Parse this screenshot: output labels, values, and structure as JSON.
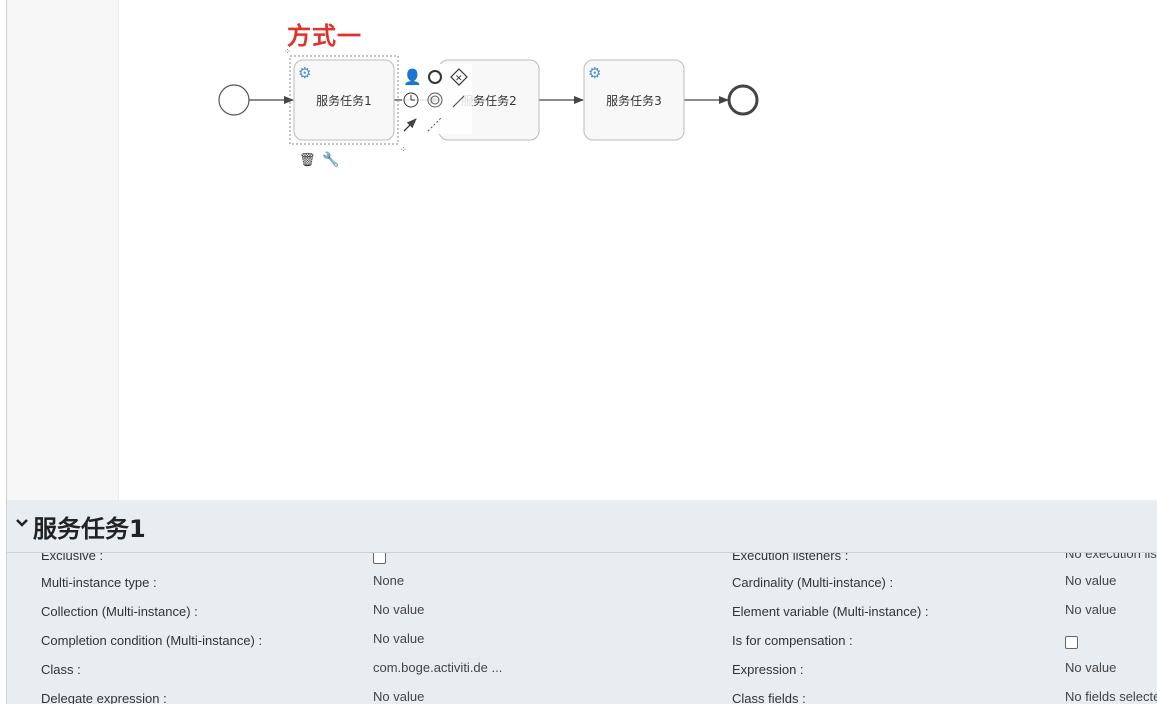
{
  "canvas": {
    "annotation": "方式一",
    "tasks": [
      {
        "label": "服务任务1"
      },
      {
        "label": "服务任务2"
      },
      {
        "label": "服务任务3"
      }
    ]
  },
  "properties": {
    "title": "服务任务1",
    "rows": [
      {
        "left_label": "Exclusive :",
        "left_value": "",
        "left_checkbox": true,
        "right_label": "Execution listeners :",
        "right_value": "No execution listeners configured",
        "right_checkbox": false
      },
      {
        "left_label": "Multi-instance type :",
        "left_value": "None",
        "left_checkbox": false,
        "right_label": "Cardinality (Multi-instance) :",
        "right_value": "No value",
        "right_checkbox": false
      },
      {
        "left_label": "Collection (Multi-instance) :",
        "left_value": "No value",
        "left_checkbox": false,
        "right_label": "Element variable (Multi-instance) :",
        "right_value": "No value",
        "right_checkbox": false
      },
      {
        "left_label": "Completion condition (Multi-instance) :",
        "left_value": "No value",
        "left_checkbox": false,
        "right_label": "Is for compensation :",
        "right_value": "",
        "right_checkbox": true
      },
      {
        "left_label": "Class :",
        "left_value": "com.boge.activiti.de ...",
        "left_checkbox": false,
        "right_label": "Expression :",
        "right_value": "No value",
        "right_checkbox": false
      },
      {
        "left_label": "Delegate expression :",
        "left_value": "No value",
        "left_checkbox": false,
        "right_label": "Class fields :",
        "right_value": "No fields selected",
        "right_checkbox": false
      }
    ]
  },
  "colors": {
    "annotation": "#e0312b",
    "gear": "#4a90d9",
    "panel_bg": "#e8edf1",
    "palette_bg": "#f7f7f7"
  }
}
